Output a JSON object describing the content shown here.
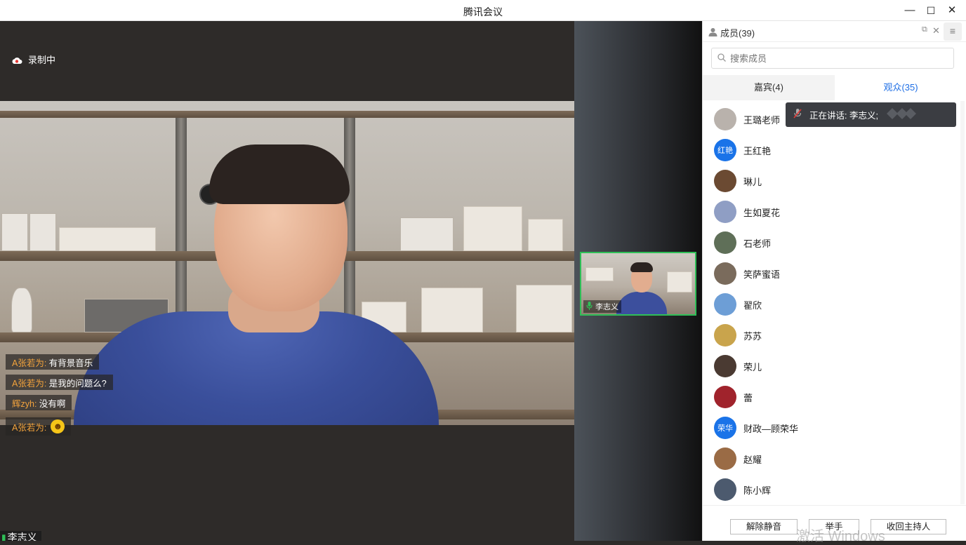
{
  "window": {
    "title": "腾讯会议",
    "min": "—",
    "max": "☐",
    "close": "✕"
  },
  "stage": {
    "recording_label": "录制中",
    "speaker_tag": "李志义",
    "chat": [
      {
        "who": "A张若为:",
        "text": "有背景音乐"
      },
      {
        "who": "A张若为:",
        "text": "是我的问题么?"
      },
      {
        "who": "辉zyh:",
        "text": "没有啊"
      },
      {
        "who": "A张若为:",
        "text": "",
        "emoji": "grinning-face"
      }
    ]
  },
  "gallery": {
    "thumb_name": "李志义"
  },
  "panel": {
    "title": "成员(39)",
    "search_placeholder": "搜索成员",
    "tabs": [
      {
        "label": "嘉宾(4)",
        "active": false
      },
      {
        "label": "观众(35)",
        "active": true
      }
    ],
    "speaking_text": "正在讲话: 李志义;",
    "members": [
      {
        "name": "王璐老师",
        "avatar_text": "",
        "color": "#b9b2ac"
      },
      {
        "name": "王红艳",
        "avatar_text": "红艳",
        "color": "#1a73e8"
      },
      {
        "name": "琳儿",
        "avatar_text": "",
        "color": "#6b4a32"
      },
      {
        "name": "生如夏花",
        "avatar_text": "",
        "color": "#8f9ec4"
      },
      {
        "name": "石老师",
        "avatar_text": "",
        "color": "#5f6f58"
      },
      {
        "name": "笑萨蜜语",
        "avatar_text": "",
        "color": "#7a6b5c"
      },
      {
        "name": "翟欣",
        "avatar_text": "",
        "color": "#6d9ed6"
      },
      {
        "name": "苏苏",
        "avatar_text": "",
        "color": "#c9a44c"
      },
      {
        "name": "荣儿",
        "avatar_text": "",
        "color": "#4a3a32"
      },
      {
        "name": "蕾",
        "avatar_text": "",
        "color": "#a0232c"
      },
      {
        "name": "财政—顾荣华",
        "avatar_text": "荣华",
        "color": "#1a73e8"
      },
      {
        "name": "赵耀",
        "avatar_text": "",
        "color": "#9a6b45"
      },
      {
        "name": "陈小辉",
        "avatar_text": "",
        "color": "#4c5a6e"
      }
    ],
    "buttons": {
      "unmute": "解除静音",
      "raise_hand": "举手",
      "reclaim_host": "收回主持人"
    }
  },
  "watermark": "激活 Windows",
  "colors": {
    "accent": "#1f6fe5",
    "chat_name": "#f3a33c",
    "active_speaker_border": "#2fbf57"
  }
}
